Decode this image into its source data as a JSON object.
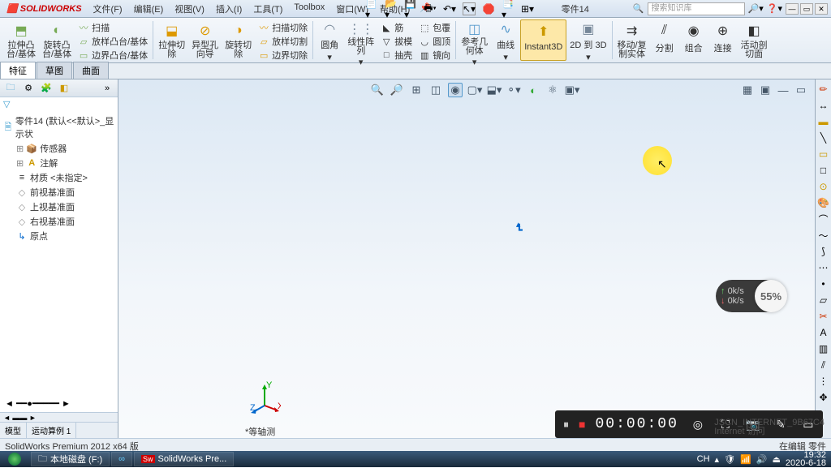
{
  "title": {
    "app": "SOLIDWORKS",
    "doc": "零件14"
  },
  "menu": [
    "文件(F)",
    "编辑(E)",
    "视图(V)",
    "插入(I)",
    "工具(T)",
    "Toolbox",
    "窗口(W)",
    "帮助(H)"
  ],
  "search": {
    "placeholder": "搜索知识库"
  },
  "ribbon": {
    "big": [
      {
        "label": "拉伸凸\n台/基体",
        "icon": "⬒",
        "c": "#7a5"
      },
      {
        "label": "旋转凸\n台/基体",
        "icon": "◐",
        "c": "#7a5"
      }
    ],
    "g1": [
      {
        "label": "扫描",
        "icon": "〰"
      },
      {
        "label": "放样凸台/基体",
        "icon": "▱"
      },
      {
        "label": "边界凸台/基体",
        "icon": "▭"
      }
    ],
    "big2": [
      {
        "label": "拉伸切\n除",
        "icon": "⬓",
        "c": "#d90"
      },
      {
        "label": "异型孔\n向导",
        "icon": "⊘",
        "c": "#d90"
      },
      {
        "label": "旋转切\n除",
        "icon": "◑",
        "c": "#d90"
      }
    ],
    "g2": [
      {
        "label": "扫描切除",
        "icon": "〰"
      },
      {
        "label": "放样切割",
        "icon": "▱"
      },
      {
        "label": "边界切除",
        "icon": "▭"
      }
    ],
    "big3": [
      {
        "label": "圆角",
        "icon": "◠",
        "c": "#789"
      },
      {
        "label": "线性阵\n列",
        "icon": "⋮⋮",
        "c": "#789"
      }
    ],
    "g3": [
      {
        "label": "筋",
        "icon": "◣"
      },
      {
        "label": "拔模",
        "icon": "▽"
      },
      {
        "label": "抽壳",
        "icon": "□"
      }
    ],
    "g4": [
      {
        "label": "包覆",
        "icon": "⬚"
      },
      {
        "label": "圆顶",
        "icon": "◡"
      },
      {
        "label": "镜向",
        "icon": "▥"
      }
    ],
    "big4": [
      {
        "label": "参考几\n何体",
        "icon": "◫",
        "c": "#59c"
      },
      {
        "label": "曲线",
        "icon": "∿",
        "c": "#59c"
      },
      {
        "label": "Instant3D",
        "icon": "⬆",
        "c": "#c90",
        "active": true
      },
      {
        "label": "2D 到 3D",
        "icon": "▣",
        "c": "#789"
      }
    ],
    "big5": [
      {
        "label": "移动/复\n制实体",
        "icon": "⇉"
      },
      {
        "label": "分割",
        "icon": "⫽"
      },
      {
        "label": "组合",
        "icon": "◉"
      },
      {
        "label": "连接",
        "icon": "⊕"
      },
      {
        "label": "活动剖\n切面",
        "icon": "◧"
      }
    ]
  },
  "tabs": [
    "特征",
    "草图",
    "曲面"
  ],
  "lp_tabs_icons": [
    "🗀",
    "⚙",
    "🧩",
    "◧",
    "≡"
  ],
  "tree": [
    {
      "label": "零件14 (默认<<默认>_显示状",
      "icon": "🗎",
      "c": "#39c"
    },
    {
      "label": "传感器",
      "icon": "📦",
      "indent": true,
      "c": "#c90"
    },
    {
      "label": "注解",
      "icon": "A",
      "indent": true,
      "c": "#c90"
    },
    {
      "label": "材质 <未指定>",
      "icon": "≡",
      "indent": true
    },
    {
      "label": "前视基准面",
      "icon": "◇",
      "indent": true
    },
    {
      "label": "上视基准面",
      "icon": "◇",
      "indent": true
    },
    {
      "label": "右视基准面",
      "icon": "◇",
      "indent": true
    },
    {
      "label": "原点",
      "icon": "↳",
      "indent": true
    }
  ],
  "lp_btabs": [
    "模型",
    "运动算例 1"
  ],
  "vp_icons": [
    "🔍",
    "🔎",
    "⊞",
    "◫",
    "▣",
    "◉",
    "▢",
    "▾",
    "⬓",
    "▾",
    "⚬",
    "▾",
    "◐",
    "⚛",
    "▣",
    "▾"
  ],
  "view_label": "*等轴测",
  "speed": {
    "up": "0k/s",
    "down": "0k/s",
    "pct": "55%"
  },
  "status": {
    "left": "SolidWorks Premium 2012 x64 版",
    "mid": "在编辑 零件",
    "net1": "JSCN_INTERNET_9B67C4",
    "net2": "Internet 访问"
  },
  "recorder": {
    "time": "00:00:00"
  },
  "taskbar": {
    "items": [
      {
        "label": "本地磁盘 (F:)",
        "icon": "🗀"
      },
      {
        "label": "",
        "icon": "∞"
      },
      {
        "label": "SolidWorks Pre...",
        "icon": "Sw",
        "c": "#c00"
      }
    ],
    "clock": {
      "time": "19:32",
      "date": "2020-6-18"
    },
    "lang": "CH"
  }
}
